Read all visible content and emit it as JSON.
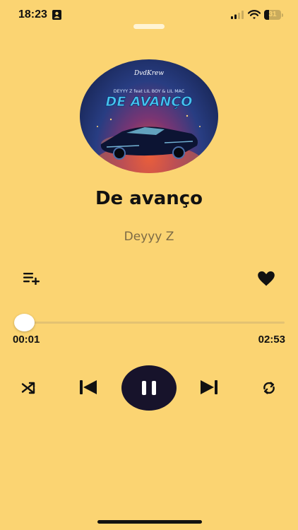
{
  "status_bar": {
    "time": "18:23",
    "battery": "31",
    "battery_level": 0.31
  },
  "player": {
    "album_art": {
      "brand": "DvdKrew",
      "credits": "DEYYY Z feat LIL BOY & LIL MAC",
      "title": "DE AVANÇO"
    },
    "song_title": "De avanço",
    "artist": "Deyyy Z",
    "favorite": true,
    "progress": {
      "elapsed": "00:01",
      "total": "02:53",
      "fraction": 0.006
    },
    "is_playing": true
  },
  "colors": {
    "background": "#FBD472",
    "play_button": "#17132B",
    "text_primary": "#111111",
    "artist_text": "#7C6A45"
  },
  "icons": [
    "contact-card-icon",
    "signal-icon",
    "wifi-icon",
    "battery-icon",
    "add-to-queue-icon",
    "heart-icon",
    "shuffle-icon",
    "previous-icon",
    "pause-icon",
    "next-icon",
    "repeat-icon"
  ]
}
